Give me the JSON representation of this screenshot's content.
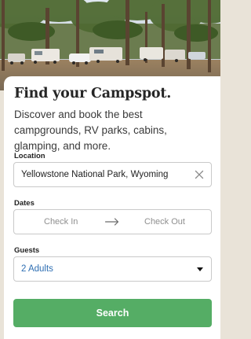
{
  "hero": {
    "alt_subject": "campground-photo"
  },
  "title": "Find your Campspot.",
  "subtitle": "Discover and book the best campgrounds, RV parks, cabins, glamping, and more.",
  "location": {
    "label": "Location",
    "value": "Yellowstone National Park, Wyoming",
    "clear_icon": "close-icon"
  },
  "dates": {
    "label": "Dates",
    "check_in": "Check In",
    "check_out": "Check Out",
    "arrow_icon": "arrow-right-icon"
  },
  "guests": {
    "label": "Guests",
    "value": "2 Adults",
    "caret_icon": "chevron-down-icon"
  },
  "search": {
    "label": "Search"
  },
  "colors": {
    "accent": "#55ad65",
    "link": "#2f6fb3"
  }
}
